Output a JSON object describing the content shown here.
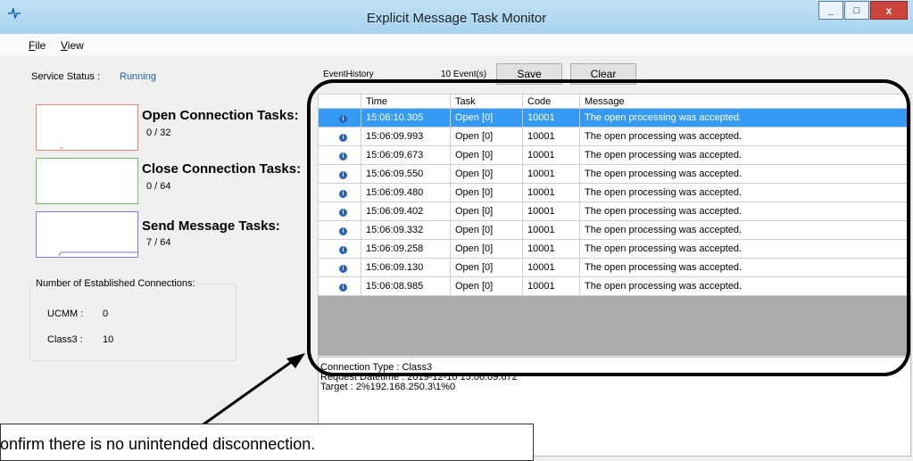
{
  "window": {
    "title": "Explicit Message Task Monitor",
    "icon": "pulse-icon",
    "controls": {
      "minimize": "_",
      "maximize": "□",
      "close": "x"
    }
  },
  "menu": {
    "file": "File",
    "file_mnemonic": "F",
    "file_rest": "ile",
    "view": "View",
    "view_mnemonic": "V",
    "view_rest": "iew"
  },
  "service": {
    "label": "Service Status :",
    "value": "Running"
  },
  "tasks": [
    {
      "title": "Open Connection Tasks:",
      "count": "0 / 32",
      "color": "#e8867c"
    },
    {
      "title": "Close Connection Tasks:",
      "count": "0 / 64",
      "color": "#6bbf59"
    },
    {
      "title": "Send Message Tasks:",
      "count": "7 / 64",
      "color": "#8c7ad6"
    }
  ],
  "connections": {
    "group_label": "Number of Established Connections:",
    "ucmm_label": "UCMM :",
    "ucmm_value": "0",
    "class3_label": "Class3 :",
    "class3_value": "10"
  },
  "events": {
    "label": "EventHistory",
    "count": "10 Event(s)",
    "save": "Save",
    "clear": "Clear",
    "columns": [
      "",
      "Time",
      "Task",
      "Code",
      "Message"
    ],
    "rows": [
      {
        "time": "15:06:10.305",
        "task": "Open [0]",
        "code": "10001",
        "message": "The open processing was accepted.",
        "selected": true
      },
      {
        "time": "15:06:09.993",
        "task": "Open [0]",
        "code": "10001",
        "message": "The open processing was accepted."
      },
      {
        "time": "15:06:09.673",
        "task": "Open [0]",
        "code": "10001",
        "message": "The open processing was accepted."
      },
      {
        "time": "15:06:09.550",
        "task": "Open [0]",
        "code": "10001",
        "message": "The open processing was accepted."
      },
      {
        "time": "15:06:09.480",
        "task": "Open [0]",
        "code": "10001",
        "message": "The open processing was accepted."
      },
      {
        "time": "15:06:09.402",
        "task": "Open [0]",
        "code": "10001",
        "message": "The open processing was accepted."
      },
      {
        "time": "15:06:09.332",
        "task": "Open [0]",
        "code": "10001",
        "message": "The open processing was accepted."
      },
      {
        "time": "15:06:09.258",
        "task": "Open [0]",
        "code": "10001",
        "message": "The open processing was accepted."
      },
      {
        "time": "15:06:09.130",
        "task": "Open [0]",
        "code": "10001",
        "message": "The open processing was accepted."
      },
      {
        "time": "15:06:08.985",
        "task": "Open [0]",
        "code": "10001",
        "message": "The open processing was accepted."
      }
    ]
  },
  "detail": {
    "line1": "Connection Type : Class3",
    "line2": "Request Datetime : 2019-12-10 15:06:09.672",
    "line3": "Target : 2%192.168.250.3\\1%0"
  },
  "callout": {
    "text": "Confirm there is no unintended disconnection."
  },
  "colors": {
    "selection": "#3399f3",
    "running": "#1a5fb4",
    "highlight_ring": "#000000"
  }
}
